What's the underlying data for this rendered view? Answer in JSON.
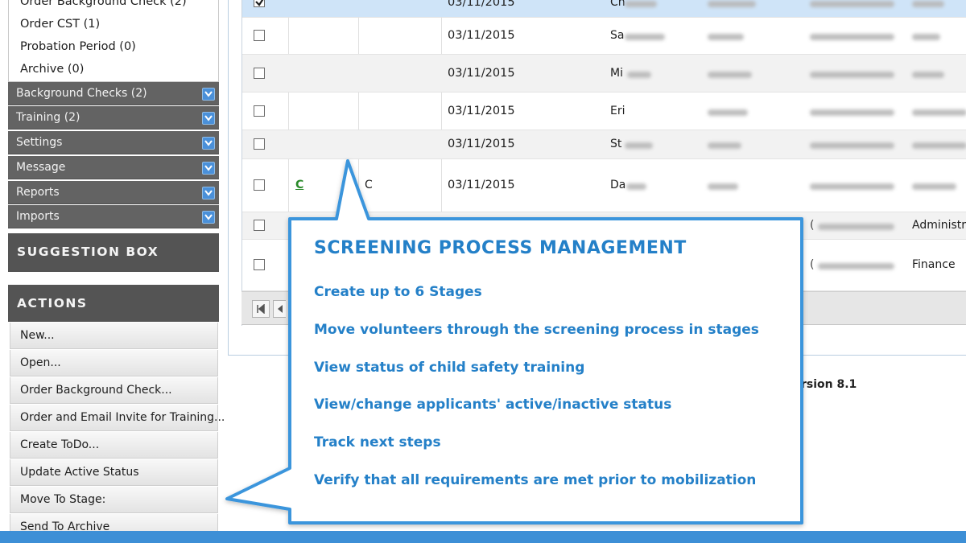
{
  "sidebar": {
    "folders": [
      {
        "label": "Order Background Check (2)"
      },
      {
        "label": "Order CST (1)"
      },
      {
        "label": "Probation Period (0)"
      },
      {
        "label": "Archive (0)"
      }
    ],
    "categories": [
      {
        "label": "Background Checks (2)"
      },
      {
        "label": "Training (2)"
      },
      {
        "label": "Settings"
      },
      {
        "label": "Message"
      },
      {
        "label": "Reports"
      },
      {
        "label": "Imports"
      }
    ],
    "suggestion_label": "SUGGESTION BOX",
    "actions_label": "ACTIONS",
    "actions": [
      {
        "label": "New..."
      },
      {
        "label": "Open..."
      },
      {
        "label": "Order Background Check..."
      },
      {
        "label": "Order and Email Invite for Training..."
      },
      {
        "label": "Create ToDo..."
      },
      {
        "label": "Update Active Status"
      },
      {
        "label": "Move To Stage:"
      },
      {
        "label": "Send To Archive"
      }
    ]
  },
  "grid": {
    "rows": [
      {
        "date": "03/11/2015",
        "name": "Ch",
        "checked": true
      },
      {
        "date": "03/11/2015",
        "name": "Sa",
        "checked": false
      },
      {
        "date": "03/11/2015",
        "name": "Mi",
        "checked": false
      },
      {
        "date": "03/11/2015",
        "name": "Eri",
        "checked": false
      },
      {
        "date": "03/11/2015",
        "name": "St",
        "checked": false
      },
      {
        "date": "03/11/2015",
        "name": "Da",
        "checked": false,
        "code_a": "C",
        "code_b": "C"
      },
      {
        "date": "",
        "name": "",
        "checked": false,
        "phone": "(",
        "dept": "Administra"
      },
      {
        "date": "",
        "name": "",
        "checked": false,
        "phone": "(",
        "dept": "Finance"
      }
    ],
    "pager": {
      "first_icon": "first-page-icon",
      "prev_icon": "prev-page-icon"
    },
    "version": "rsion 8.1"
  },
  "callout": {
    "title": "SCREENING PROCESS MANAGEMENT",
    "features": [
      "Create up to 6 Stages",
      "Move volunteers through the screening process in stages",
      "View status of child safety training",
      "View/change applicants' active/inactive status",
      "Track next steps",
      "Verify that all requirements are met prior to mobilization"
    ]
  },
  "colors": {
    "accent": "#2480c8",
    "callout_border": "#3a95dc",
    "sidebar_category": "#636363",
    "panel_header": "#545454",
    "selected_row": "#cfe4f8",
    "bottom_bar": "#3d8fd6"
  }
}
